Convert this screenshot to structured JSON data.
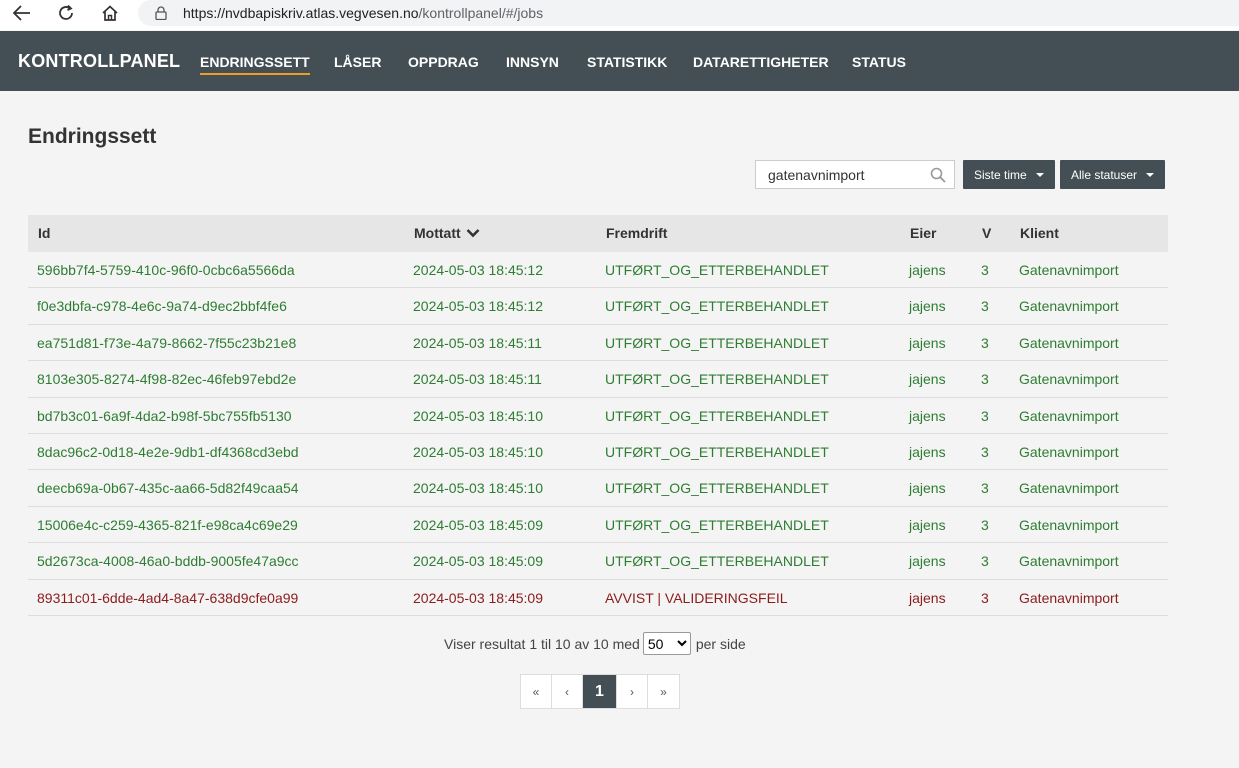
{
  "browser": {
    "url_host": "https://nvdbapiskriv.atlas.vegvesen.no",
    "url_path": "/kontrollpanel/#/jobs"
  },
  "header": {
    "brand": "KONTROLLPANEL",
    "menu": [
      "ENDRINGSSETT",
      "LÅSER",
      "OPPDRAG",
      "INNSYN",
      "STATISTIKK",
      "DATARETTIGHETER",
      "STATUS"
    ]
  },
  "page": {
    "title": "Endringssett"
  },
  "filters": {
    "search_value": "gatenavnimport",
    "time_label": "Siste time",
    "status_label": "Alle statuser"
  },
  "table": {
    "columns": {
      "id": "Id",
      "mottatt": "Mottatt",
      "fremdrift": "Fremdrift",
      "eier": "Eier",
      "v": "V",
      "klient": "Klient"
    },
    "rows": [
      {
        "id": "596bb7f4-5759-410c-96f0-0cbc6a5566da",
        "mottatt": "2024-05-03 18:45:12",
        "fremdrift": "UTFØRT_OG_ETTERBEHANDLET",
        "eier": "jajens",
        "v": "3",
        "klient": "Gatenavnimport",
        "status": "ok"
      },
      {
        "id": "f0e3dbfa-c978-4e6c-9a74-d9ec2bbf4fe6",
        "mottatt": "2024-05-03 18:45:12",
        "fremdrift": "UTFØRT_OG_ETTERBEHANDLET",
        "eier": "jajens",
        "v": "3",
        "klient": "Gatenavnimport",
        "status": "ok"
      },
      {
        "id": "ea751d81-f73e-4a79-8662-7f55c23b21e8",
        "mottatt": "2024-05-03 18:45:11",
        "fremdrift": "UTFØRT_OG_ETTERBEHANDLET",
        "eier": "jajens",
        "v": "3",
        "klient": "Gatenavnimport",
        "status": "ok"
      },
      {
        "id": "8103e305-8274-4f98-82ec-46feb97ebd2e",
        "mottatt": "2024-05-03 18:45:11",
        "fremdrift": "UTFØRT_OG_ETTERBEHANDLET",
        "eier": "jajens",
        "v": "3",
        "klient": "Gatenavnimport",
        "status": "ok"
      },
      {
        "id": "bd7b3c01-6a9f-4da2-b98f-5bc755fb5130",
        "mottatt": "2024-05-03 18:45:10",
        "fremdrift": "UTFØRT_OG_ETTERBEHANDLET",
        "eier": "jajens",
        "v": "3",
        "klient": "Gatenavnimport",
        "status": "ok"
      },
      {
        "id": "8dac96c2-0d18-4e2e-9db1-df4368cd3ebd",
        "mottatt": "2024-05-03 18:45:10",
        "fremdrift": "UTFØRT_OG_ETTERBEHANDLET",
        "eier": "jajens",
        "v": "3",
        "klient": "Gatenavnimport",
        "status": "ok"
      },
      {
        "id": "deecb69a-0b67-435c-aa66-5d82f49caa54",
        "mottatt": "2024-05-03 18:45:10",
        "fremdrift": "UTFØRT_OG_ETTERBEHANDLET",
        "eier": "jajens",
        "v": "3",
        "klient": "Gatenavnimport",
        "status": "ok"
      },
      {
        "id": "15006e4c-c259-4365-821f-e98ca4c69e29",
        "mottatt": "2024-05-03 18:45:09",
        "fremdrift": "UTFØRT_OG_ETTERBEHANDLET",
        "eier": "jajens",
        "v": "3",
        "klient": "Gatenavnimport",
        "status": "ok"
      },
      {
        "id": "5d2673ca-4008-46a0-bddb-9005fe47a9cc",
        "mottatt": "2024-05-03 18:45:09",
        "fremdrift": "UTFØRT_OG_ETTERBEHANDLET",
        "eier": "jajens",
        "v": "3",
        "klient": "Gatenavnimport",
        "status": "ok"
      },
      {
        "id": "89311c01-6dde-4ad4-8a47-638d9cfe0a99",
        "mottatt": "2024-05-03 18:45:09",
        "fremdrift": "AVVIST | VALIDERINGSFEIL",
        "eier": "jajens",
        "v": "3",
        "klient": "Gatenavnimport",
        "status": "err"
      }
    ]
  },
  "results": {
    "prefix": "Viser resultat 1 til 10 av 10 med",
    "per_page": "50",
    "suffix": "per side"
  },
  "pagination": {
    "first": "«",
    "prev": "‹",
    "current": "1",
    "next": "›",
    "last": "»"
  },
  "colors": {
    "header_bg": "#444f55",
    "active_underline": "#ed9c28",
    "ok_text": "#2e7d32",
    "error_text": "#8b1c1c"
  }
}
